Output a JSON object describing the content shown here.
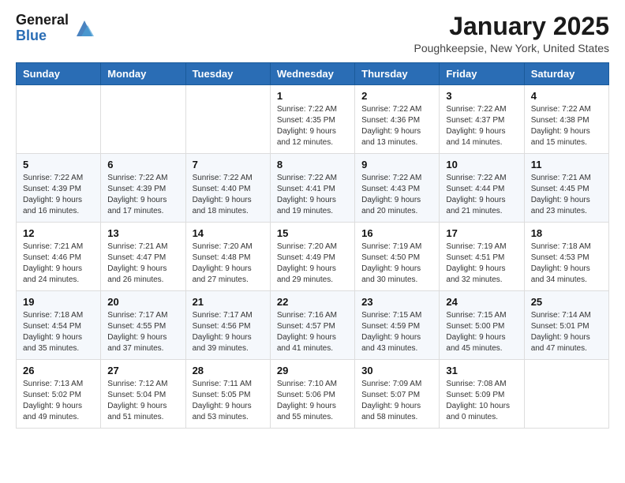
{
  "header": {
    "logo_general": "General",
    "logo_blue": "Blue",
    "month_title": "January 2025",
    "location": "Poughkeepsie, New York, United States"
  },
  "days_of_week": [
    "Sunday",
    "Monday",
    "Tuesday",
    "Wednesday",
    "Thursday",
    "Friday",
    "Saturday"
  ],
  "weeks": [
    [
      {
        "day": "",
        "info": ""
      },
      {
        "day": "",
        "info": ""
      },
      {
        "day": "",
        "info": ""
      },
      {
        "day": "1",
        "info": "Sunrise: 7:22 AM\nSunset: 4:35 PM\nDaylight: 9 hours\nand 12 minutes."
      },
      {
        "day": "2",
        "info": "Sunrise: 7:22 AM\nSunset: 4:36 PM\nDaylight: 9 hours\nand 13 minutes."
      },
      {
        "day": "3",
        "info": "Sunrise: 7:22 AM\nSunset: 4:37 PM\nDaylight: 9 hours\nand 14 minutes."
      },
      {
        "day": "4",
        "info": "Sunrise: 7:22 AM\nSunset: 4:38 PM\nDaylight: 9 hours\nand 15 minutes."
      }
    ],
    [
      {
        "day": "5",
        "info": "Sunrise: 7:22 AM\nSunset: 4:39 PM\nDaylight: 9 hours\nand 16 minutes."
      },
      {
        "day": "6",
        "info": "Sunrise: 7:22 AM\nSunset: 4:39 PM\nDaylight: 9 hours\nand 17 minutes."
      },
      {
        "day": "7",
        "info": "Sunrise: 7:22 AM\nSunset: 4:40 PM\nDaylight: 9 hours\nand 18 minutes."
      },
      {
        "day": "8",
        "info": "Sunrise: 7:22 AM\nSunset: 4:41 PM\nDaylight: 9 hours\nand 19 minutes."
      },
      {
        "day": "9",
        "info": "Sunrise: 7:22 AM\nSunset: 4:43 PM\nDaylight: 9 hours\nand 20 minutes."
      },
      {
        "day": "10",
        "info": "Sunrise: 7:22 AM\nSunset: 4:44 PM\nDaylight: 9 hours\nand 21 minutes."
      },
      {
        "day": "11",
        "info": "Sunrise: 7:21 AM\nSunset: 4:45 PM\nDaylight: 9 hours\nand 23 minutes."
      }
    ],
    [
      {
        "day": "12",
        "info": "Sunrise: 7:21 AM\nSunset: 4:46 PM\nDaylight: 9 hours\nand 24 minutes."
      },
      {
        "day": "13",
        "info": "Sunrise: 7:21 AM\nSunset: 4:47 PM\nDaylight: 9 hours\nand 26 minutes."
      },
      {
        "day": "14",
        "info": "Sunrise: 7:20 AM\nSunset: 4:48 PM\nDaylight: 9 hours\nand 27 minutes."
      },
      {
        "day": "15",
        "info": "Sunrise: 7:20 AM\nSunset: 4:49 PM\nDaylight: 9 hours\nand 29 minutes."
      },
      {
        "day": "16",
        "info": "Sunrise: 7:19 AM\nSunset: 4:50 PM\nDaylight: 9 hours\nand 30 minutes."
      },
      {
        "day": "17",
        "info": "Sunrise: 7:19 AM\nSunset: 4:51 PM\nDaylight: 9 hours\nand 32 minutes."
      },
      {
        "day": "18",
        "info": "Sunrise: 7:18 AM\nSunset: 4:53 PM\nDaylight: 9 hours\nand 34 minutes."
      }
    ],
    [
      {
        "day": "19",
        "info": "Sunrise: 7:18 AM\nSunset: 4:54 PM\nDaylight: 9 hours\nand 35 minutes."
      },
      {
        "day": "20",
        "info": "Sunrise: 7:17 AM\nSunset: 4:55 PM\nDaylight: 9 hours\nand 37 minutes."
      },
      {
        "day": "21",
        "info": "Sunrise: 7:17 AM\nSunset: 4:56 PM\nDaylight: 9 hours\nand 39 minutes."
      },
      {
        "day": "22",
        "info": "Sunrise: 7:16 AM\nSunset: 4:57 PM\nDaylight: 9 hours\nand 41 minutes."
      },
      {
        "day": "23",
        "info": "Sunrise: 7:15 AM\nSunset: 4:59 PM\nDaylight: 9 hours\nand 43 minutes."
      },
      {
        "day": "24",
        "info": "Sunrise: 7:15 AM\nSunset: 5:00 PM\nDaylight: 9 hours\nand 45 minutes."
      },
      {
        "day": "25",
        "info": "Sunrise: 7:14 AM\nSunset: 5:01 PM\nDaylight: 9 hours\nand 47 minutes."
      }
    ],
    [
      {
        "day": "26",
        "info": "Sunrise: 7:13 AM\nSunset: 5:02 PM\nDaylight: 9 hours\nand 49 minutes."
      },
      {
        "day": "27",
        "info": "Sunrise: 7:12 AM\nSunset: 5:04 PM\nDaylight: 9 hours\nand 51 minutes."
      },
      {
        "day": "28",
        "info": "Sunrise: 7:11 AM\nSunset: 5:05 PM\nDaylight: 9 hours\nand 53 minutes."
      },
      {
        "day": "29",
        "info": "Sunrise: 7:10 AM\nSunset: 5:06 PM\nDaylight: 9 hours\nand 55 minutes."
      },
      {
        "day": "30",
        "info": "Sunrise: 7:09 AM\nSunset: 5:07 PM\nDaylight: 9 hours\nand 58 minutes."
      },
      {
        "day": "31",
        "info": "Sunrise: 7:08 AM\nSunset: 5:09 PM\nDaylight: 10 hours\nand 0 minutes."
      },
      {
        "day": "",
        "info": ""
      }
    ]
  ]
}
